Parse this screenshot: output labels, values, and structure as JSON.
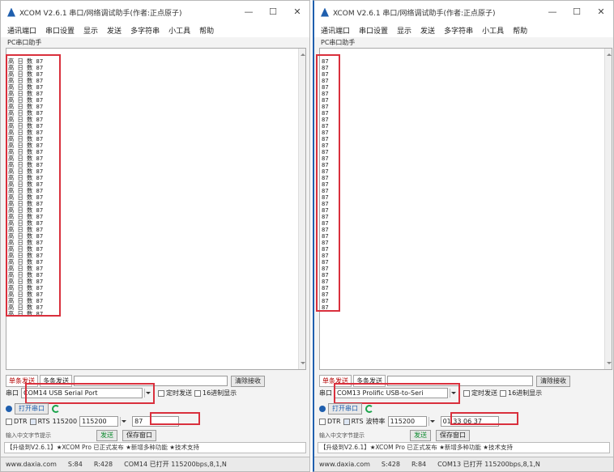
{
  "left": {
    "title": "XCOM V2.6.1 串口/网络调试助手(作者:正点原子)",
    "menu": [
      "通讯端口",
      "串口设置",
      "显示",
      "发送",
      "多字符串",
      "小工具",
      "帮助"
    ],
    "subtitle": "PC串口助手",
    "recv_line": "高 日 数 87",
    "tabs": [
      "单条发送",
      "多条发送"
    ],
    "clear_label": "清除接收",
    "port_label": "串口",
    "port_value": "COM14 USB Serial Port",
    "timed_send": "定时发送",
    "status_ok": "打开串口",
    "hex_display": "16进制显示",
    "baud_label": "波特率",
    "baud_value": "115200",
    "send_text": "87",
    "cb_dtr": "DTR",
    "cb_rts": "RTS",
    "send_btn": "发送",
    "save_btn": "保存窗口",
    "hint1": "输入中文字节提示",
    "marquee": "【升级到V2.6.1】★XCOM Pro 已正式发布  ★新增多种功能  ★技术支持",
    "status": [
      "www.daxia.com",
      "S:84",
      "R:428",
      "COM14 已打开 115200bps,8,1,N"
    ]
  },
  "right": {
    "title": "XCOM V2.6.1 串口/网络调试助手(作者:正点原子)",
    "menu": [
      "通讯端口",
      "串口设置",
      "显示",
      "发送",
      "多字符串",
      "小工具",
      "帮助"
    ],
    "subtitle": "PC串口助手",
    "recv_line": "87",
    "tabs": [
      "单条发送",
      "多条发送"
    ],
    "clear_label": "清除接收",
    "port_label": "串口",
    "port_value": "COM13 Prolific USB-to-Seri",
    "timed_send": "定时发送",
    "status_ok": "打开串口",
    "hex_display": "16进制显示",
    "baud_label": "波特率",
    "baud_value": "115200",
    "send_text": "01 33 06 37",
    "cb_dtr": "DTR",
    "cb_rts": "RTS",
    "send_btn": "发送",
    "save_btn": "保存窗口",
    "hint1": "输入中文字节提示",
    "marquee": "【升级到V2.6.1】★XCOM Pro 已正式发布  ★新增多种功能  ★技术支持",
    "status": [
      "www.daxia.com",
      "S:428",
      "R:84",
      "COM13 已打开 115200bps,8,1,N"
    ]
  }
}
